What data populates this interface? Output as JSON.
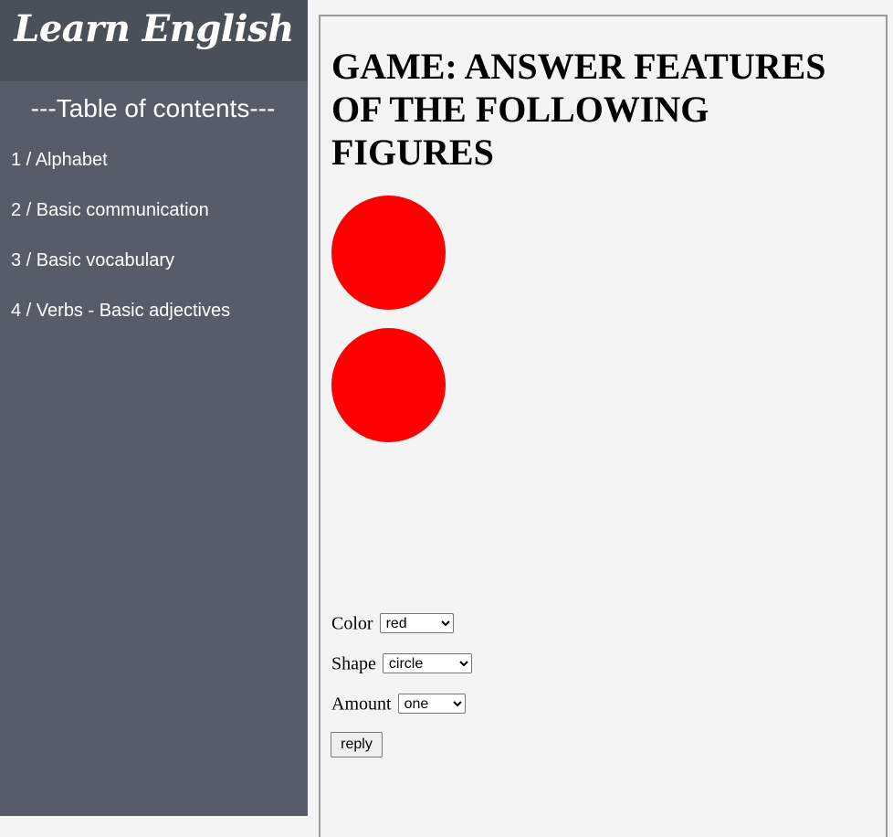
{
  "sidebar": {
    "logo": "Learn English",
    "toc_title": "---Table of contents---",
    "items": [
      {
        "label": "1 / Alphabet"
      },
      {
        "label": "2 / Basic communication"
      },
      {
        "label": "3 / Basic vocabulary"
      },
      {
        "label": "4 / Verbs - Basic adjectives"
      }
    ]
  },
  "main": {
    "title": "GAME: ANSWER FEATURES OF THE FOLLOWING FIGURES",
    "figures": [
      {
        "shape": "circle",
        "color": "#ff0000"
      },
      {
        "shape": "circle",
        "color": "#ff0000"
      }
    ],
    "form": {
      "color_label": "Color",
      "color_value": "red",
      "shape_label": "Shape",
      "shape_value": "circle",
      "amount_label": "Amount",
      "amount_value": "one",
      "reply_label": "reply"
    }
  },
  "colors": {
    "sidebar_bg": "#565d68",
    "logo_bar_bg": "#4a5059",
    "page_bg": "#f4f4f4",
    "figure_fill": "#ff0000"
  }
}
